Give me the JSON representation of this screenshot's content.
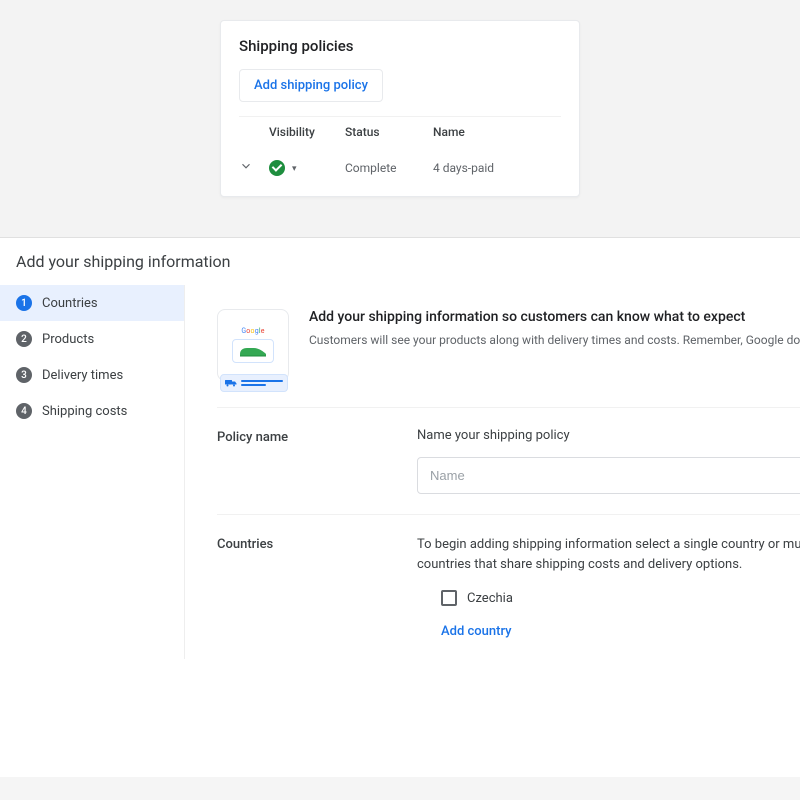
{
  "policies_card": {
    "title": "Shipping policies",
    "add_button": "Add shipping policy",
    "columns": {
      "visibility": "Visibility",
      "status": "Status",
      "name": "Name"
    },
    "rows": [
      {
        "status": "Complete",
        "name": "4 days-paid"
      }
    ]
  },
  "wizard": {
    "title": "Add your shipping information",
    "steps": [
      {
        "label": "Countries"
      },
      {
        "label": "Products"
      },
      {
        "label": "Delivery times"
      },
      {
        "label": "Shipping costs"
      }
    ],
    "active_step": 0,
    "hero": {
      "heading": "Add your shipping information so customers can know what to expect",
      "sub": "Customers will see your products along with delivery times and costs. Remember, Google does not offer shipp"
    },
    "policy_name": {
      "label": "Policy name",
      "helper": "Name your shipping policy",
      "placeholder": "Name"
    },
    "countries": {
      "label": "Countries",
      "helper": "To begin adding shipping information select a single country or multiple countries that share shipping costs and delivery options.",
      "options": [
        {
          "label": "Czechia",
          "checked": false
        }
      ],
      "add_link": "Add country"
    }
  }
}
